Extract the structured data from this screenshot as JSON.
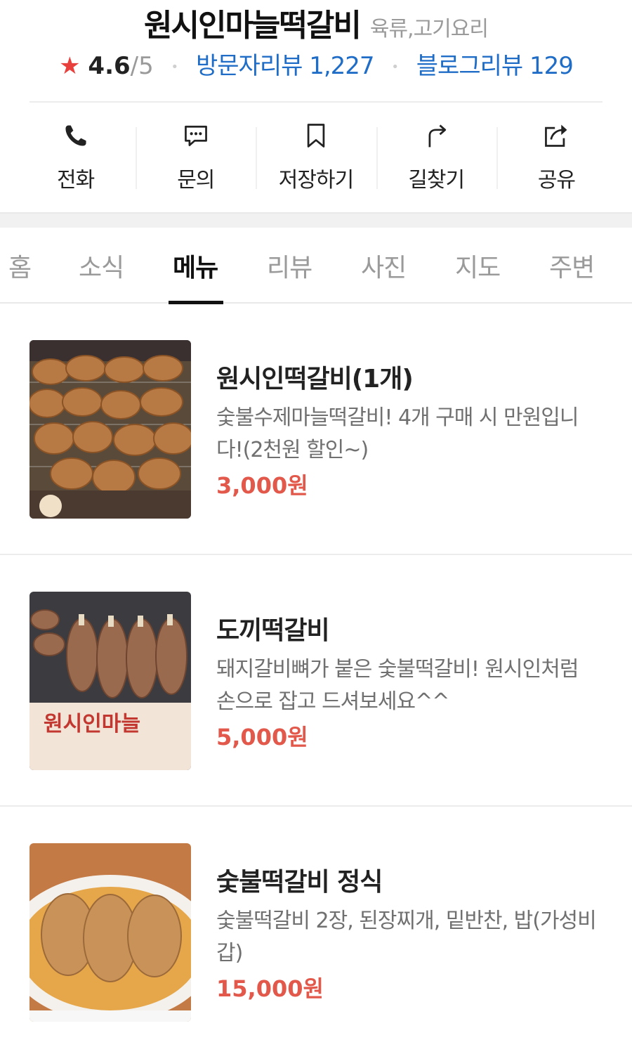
{
  "header": {
    "title": "원시인마늘떡갈비",
    "category": "육류,고기요리",
    "rating": "4.6",
    "rating_total": "/5",
    "visitor_reviews": "방문자리뷰 1,227",
    "blog_reviews": "블로그리뷰 129"
  },
  "actions": [
    {
      "label": "전화",
      "icon": "phone-icon"
    },
    {
      "label": "문의",
      "icon": "chat-icon"
    },
    {
      "label": "저장하기",
      "icon": "bookmark-icon"
    },
    {
      "label": "길찾기",
      "icon": "directions-icon"
    },
    {
      "label": "공유",
      "icon": "share-icon"
    }
  ],
  "tabs": [
    {
      "label": "홈"
    },
    {
      "label": "소식"
    },
    {
      "label": "메뉴",
      "active": true
    },
    {
      "label": "리뷰"
    },
    {
      "label": "사진"
    },
    {
      "label": "지도"
    },
    {
      "label": "주변"
    }
  ],
  "menu": [
    {
      "name": "원시인떡갈비(1개)",
      "desc": "숯불수제마늘떡갈비! 4개 구매 시 만원입니다!(2천원 할인~)",
      "price": "3,000원"
    },
    {
      "name": "도끼떡갈비",
      "desc": "돼지갈비뼈가 붙은 숯불떡갈비! 원시인처럼 손으로 잡고 드셔보세요^^",
      "price": "5,000원",
      "photo_text": "원시인마늘"
    },
    {
      "name": "숯불떡갈비 정식",
      "desc": "숯불떡갈비 2장, 된장찌개, 밑반찬, 밥(가성비 갑)",
      "price": "15,000원"
    }
  ],
  "colors": {
    "accent_star": "#e8413d",
    "link": "#1f6dc6",
    "price": "#e2594b"
  }
}
